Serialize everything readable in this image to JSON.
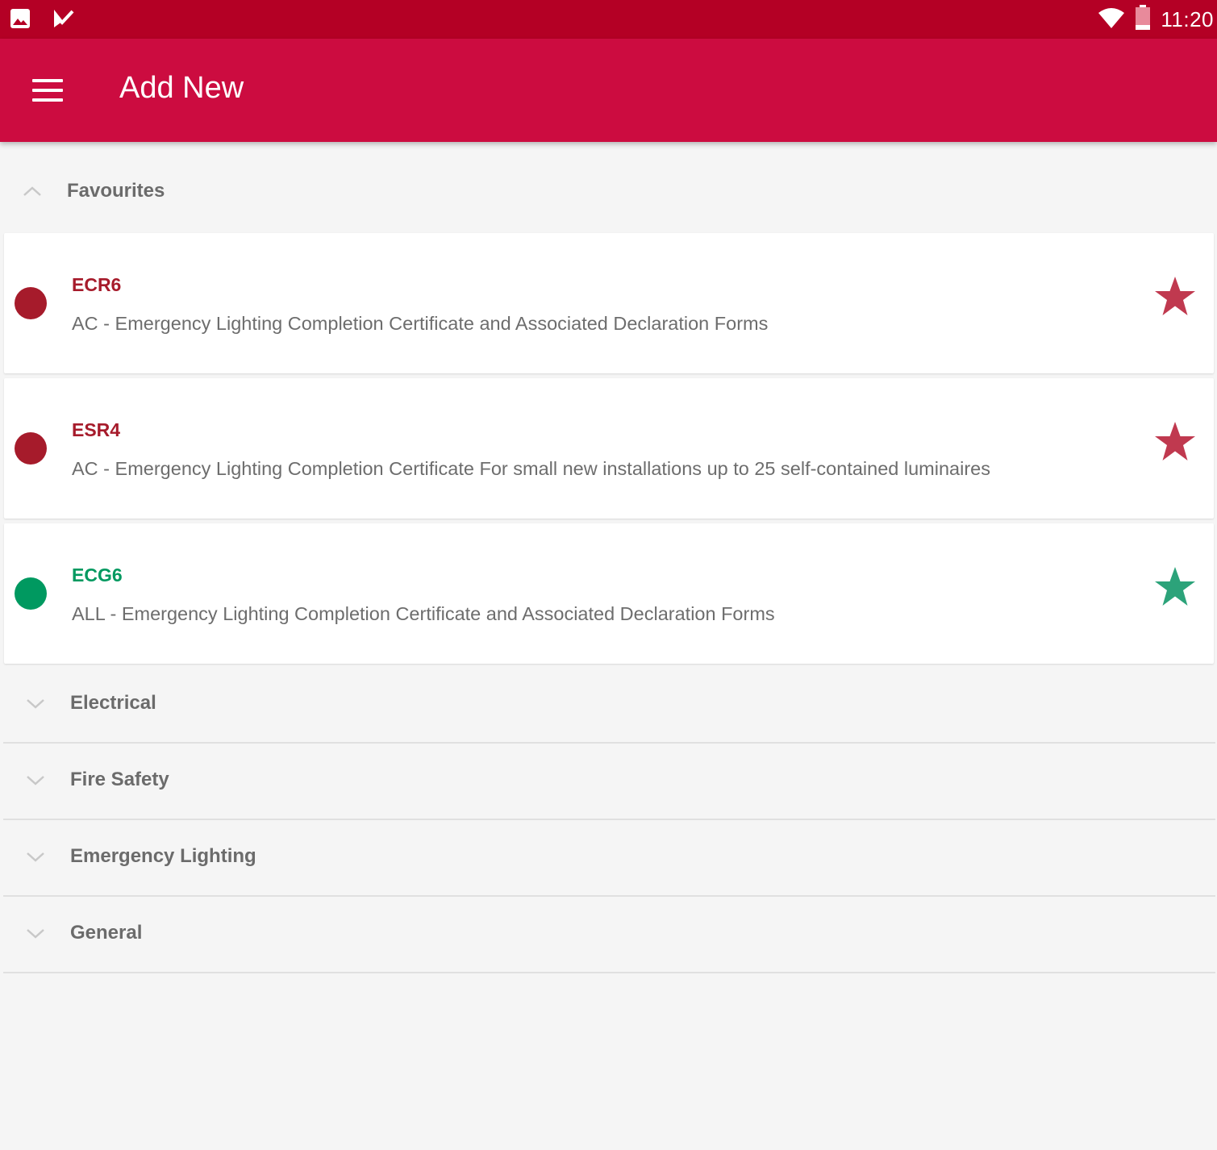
{
  "status_bar": {
    "time": "11:20",
    "icons": [
      "image-icon",
      "check-app-icon",
      "wifi-icon",
      "battery-icon"
    ]
  },
  "app_bar": {
    "title": "Add New",
    "menu_icon": "hamburger-menu-icon"
  },
  "colors": {
    "status_bar": "#b40025",
    "app_bar": "#cc0c40",
    "red_item": "#a61b2b",
    "red_star": "#c0394f",
    "green_item": "#009960",
    "green_star": "#2ca37a"
  },
  "favourites": {
    "label": "Favourites",
    "expanded": true,
    "items": [
      {
        "code": "ECR6",
        "description": "AC - Emergency Lighting Completion Certificate and Associated Declaration Forms",
        "color": "red",
        "favourite": true
      },
      {
        "code": "ESR4",
        "description": "AC - Emergency Lighting Completion Certificate For small new installations up to 25 self-contained luminaires",
        "color": "red",
        "favourite": true
      },
      {
        "code": "ECG6",
        "description": "ALL - Emergency Lighting Completion Certificate and Associated Declaration Forms",
        "color": "green",
        "favourite": true
      }
    ]
  },
  "categories": [
    {
      "label": "Electrical",
      "expanded": false
    },
    {
      "label": "Fire Safety",
      "expanded": false
    },
    {
      "label": "Emergency Lighting",
      "expanded": false
    },
    {
      "label": "General",
      "expanded": false
    }
  ]
}
